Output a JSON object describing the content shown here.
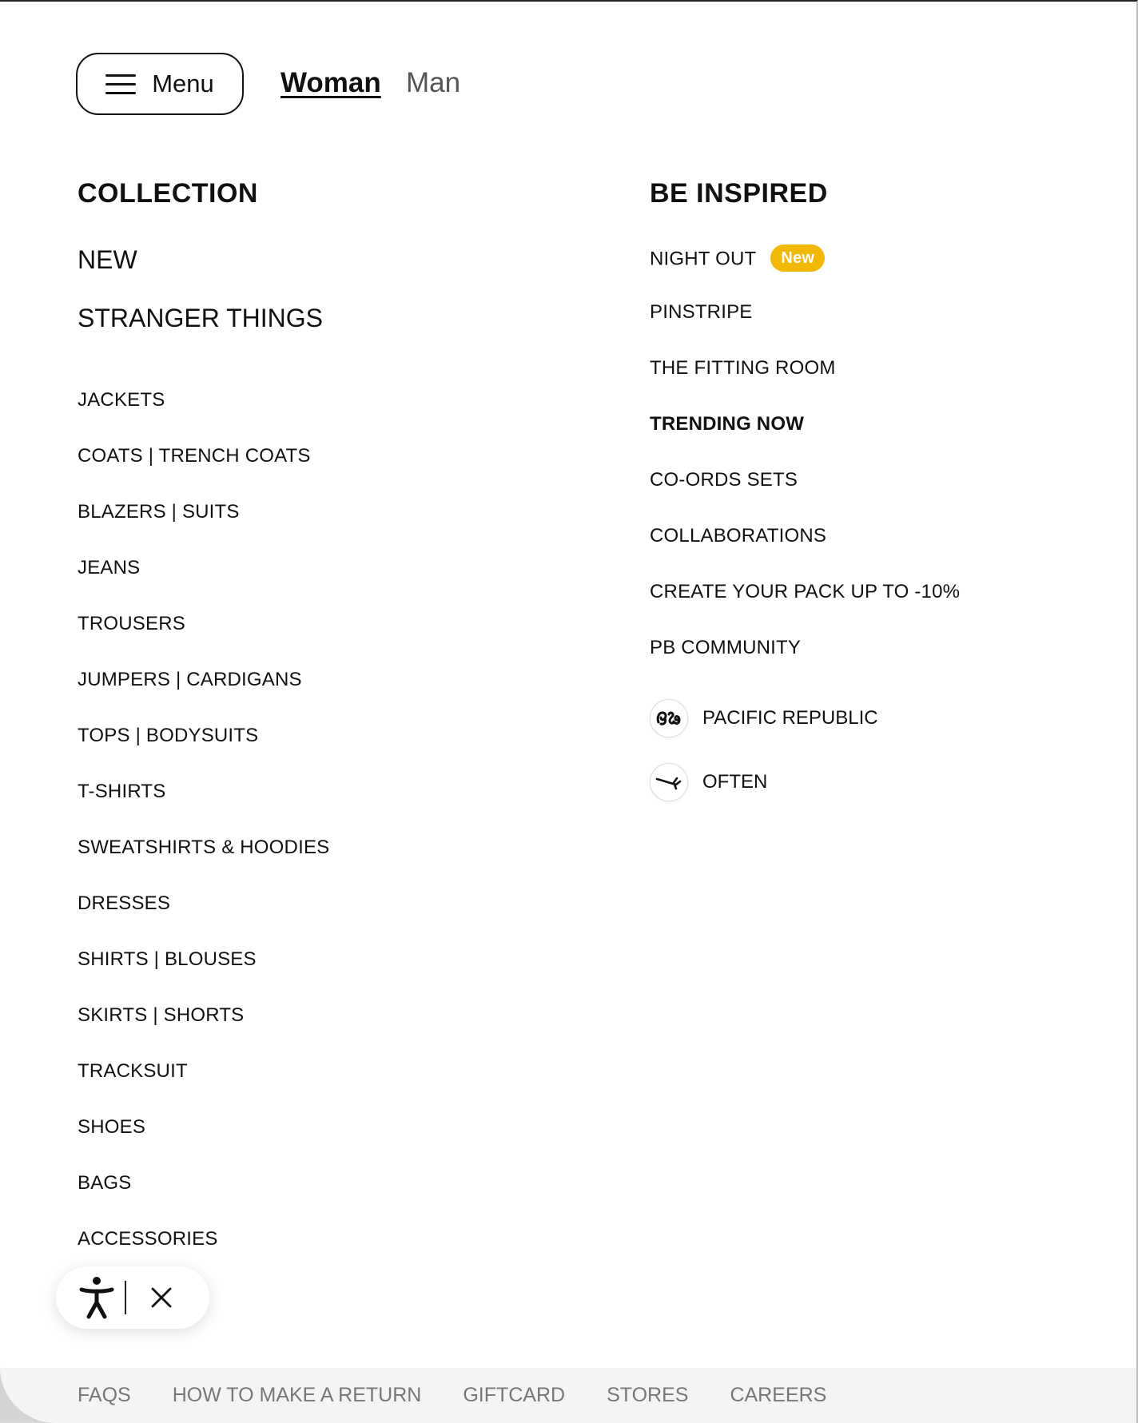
{
  "header": {
    "menu_label": "Menu",
    "genders": [
      {
        "label": "Woman",
        "active": true
      },
      {
        "label": "Man",
        "active": false
      }
    ]
  },
  "collection": {
    "title": "COLLECTION",
    "featured": [
      "NEW",
      "STRANGER THINGS"
    ],
    "categories": [
      "JACKETS",
      "COATS | TRENCH COATS",
      "BLAZERS | SUITS",
      "JEANS",
      "TROUSERS",
      "JUMPERS | CARDIGANS",
      "TOPS | BODYSUITS",
      "T-SHIRTS",
      "SWEATSHIRTS & HOODIES",
      "DRESSES",
      "SHIRTS | BLOUSES",
      "SKIRTS | SHORTS",
      "TRACKSUIT",
      "SHOES",
      "BAGS",
      "ACCESSORIES"
    ]
  },
  "inspired": {
    "title": "BE INSPIRED",
    "items": [
      {
        "label": "NIGHT OUT",
        "badge": "New",
        "bold": false
      },
      {
        "label": "PINSTRIPE",
        "bold": false
      },
      {
        "label": "THE FITTING ROOM",
        "bold": false
      },
      {
        "label": "TRENDING NOW",
        "bold": true
      },
      {
        "label": "CO-ORDS SETS",
        "bold": false
      },
      {
        "label": "COLLABORATIONS",
        "bold": false
      },
      {
        "label": "CREATE YOUR PACK UP TO -10%",
        "bold": false
      },
      {
        "label": "PB COMMUNITY",
        "bold": false
      }
    ],
    "brands": [
      {
        "label": "PACIFIC REPUBLIC",
        "icon": "pacific-republic-logo-icon"
      },
      {
        "label": "OFTEN",
        "icon": "often-logo-icon"
      }
    ]
  },
  "accessibility_widget": {
    "icon": "accessibility-person-icon",
    "close_icon": "close-icon"
  },
  "footer": {
    "links": [
      "FAQS",
      "HOW TO MAKE A RETURN",
      "GIFTCARD",
      "STORES",
      "CAREERS"
    ]
  },
  "colors": {
    "badge": "#f2b806",
    "text": "#111111",
    "footer_bg": "#f4f4f4",
    "footer_text": "#777777"
  }
}
